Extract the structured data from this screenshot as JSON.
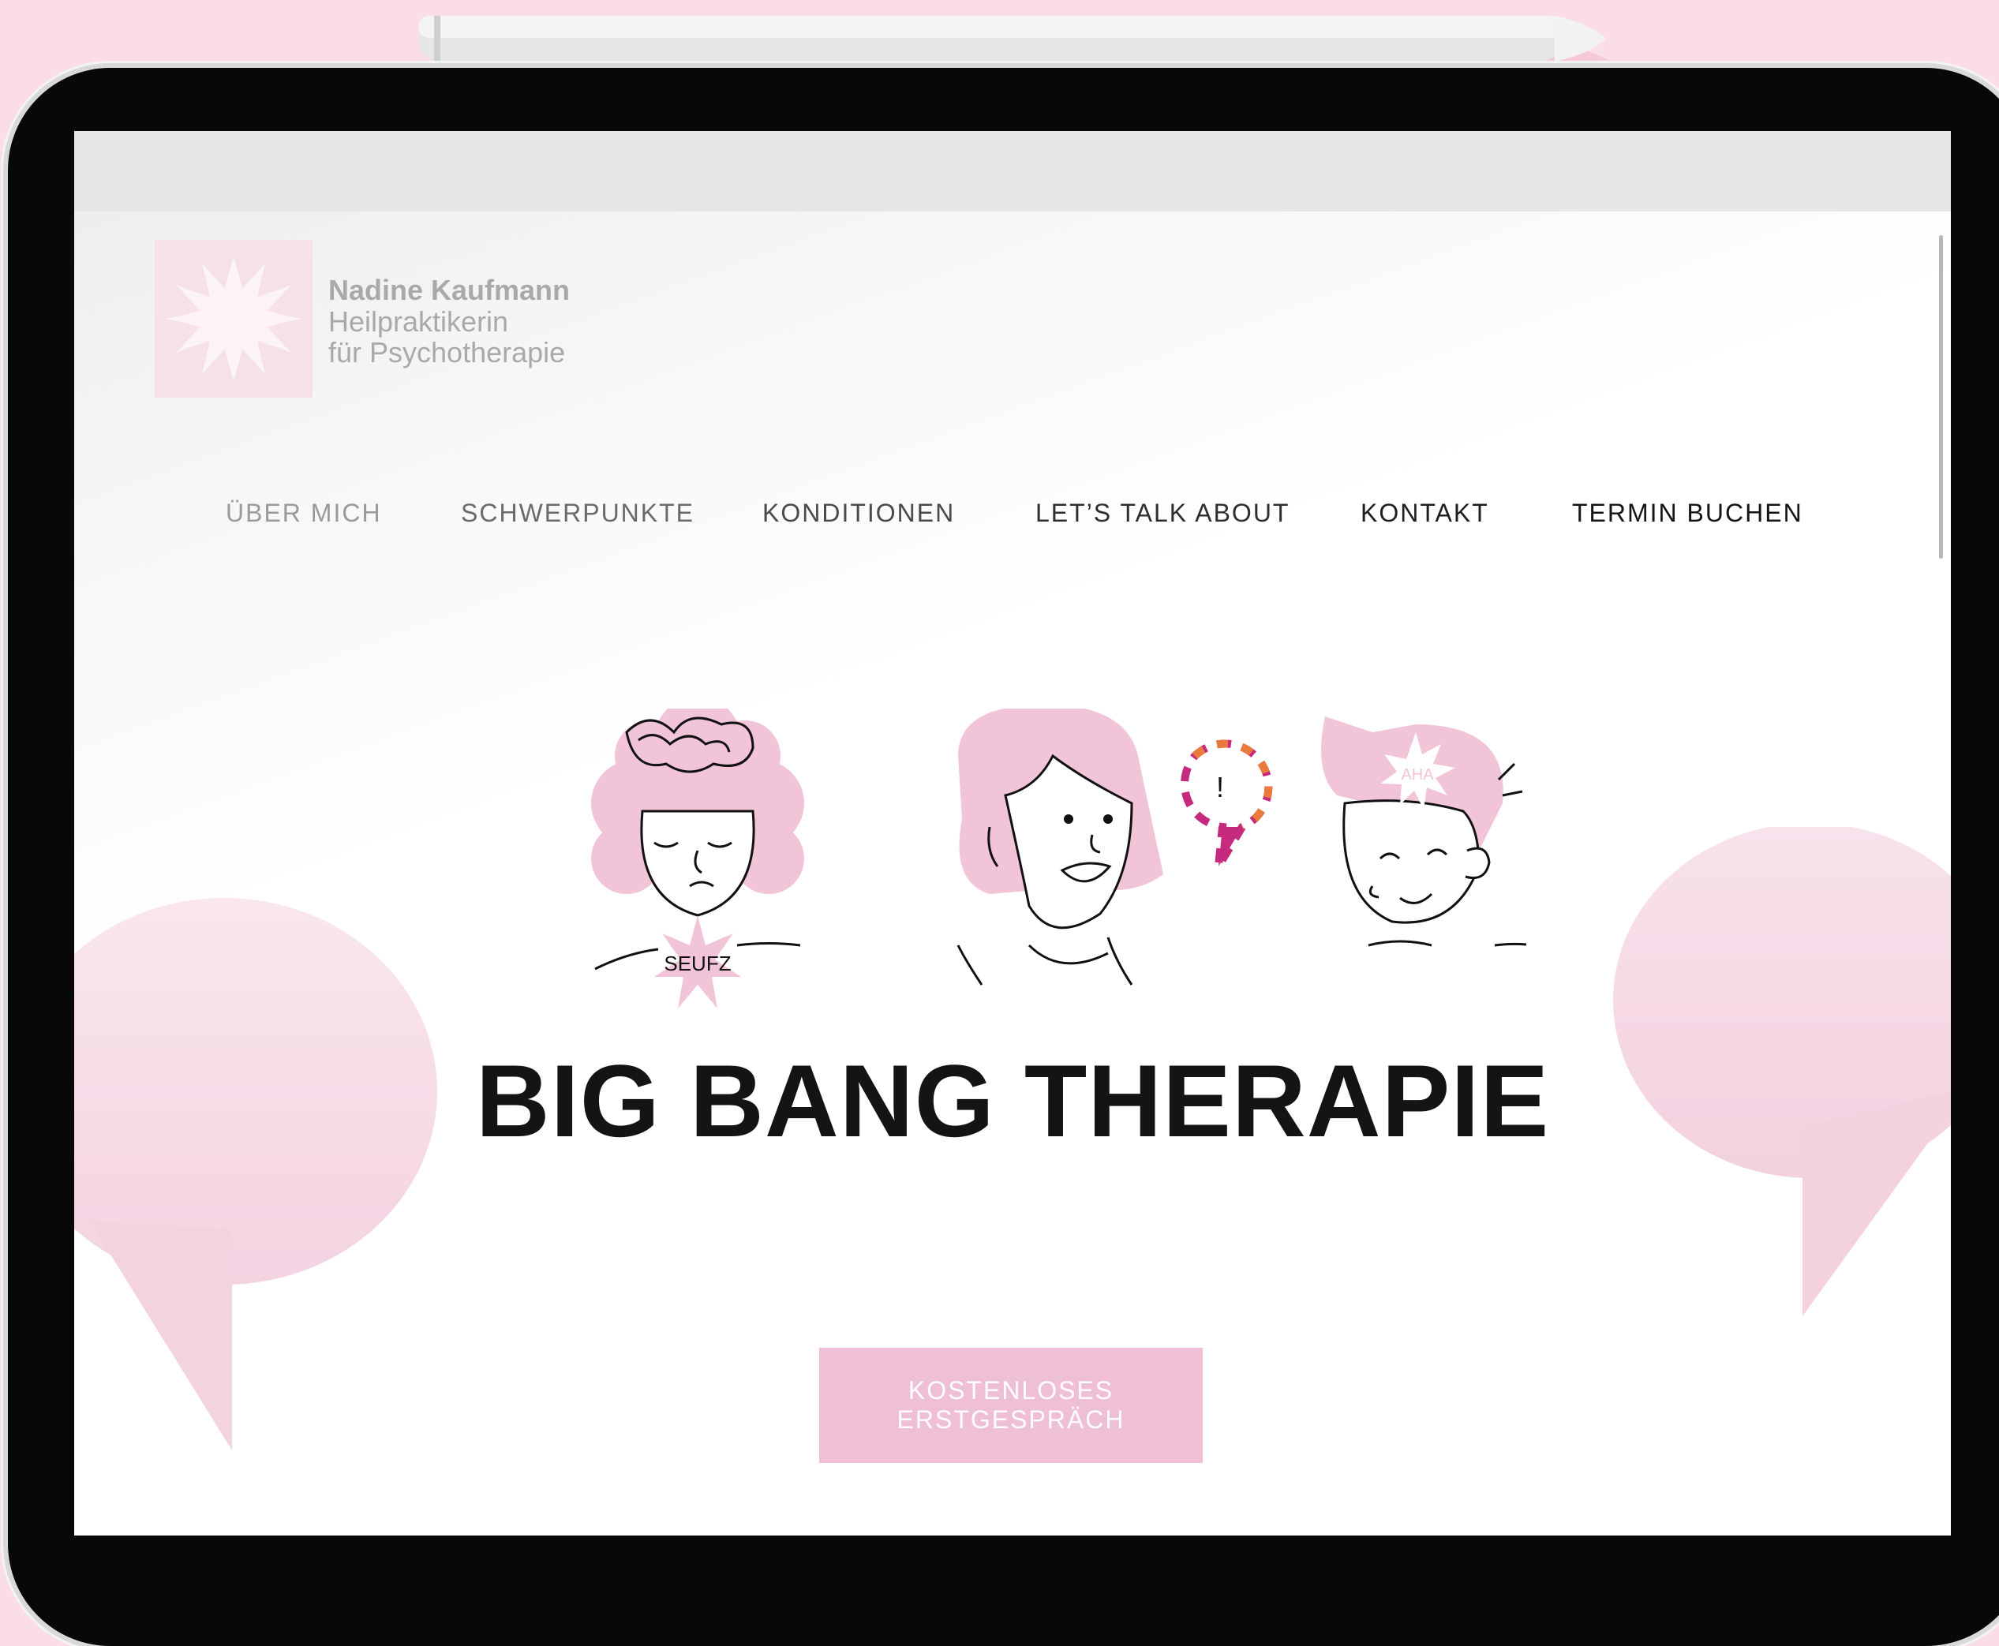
{
  "colors": {
    "background": "#fbdde9",
    "accent_pink": "#efbfd5",
    "bubble_pink": "#f5d6e3",
    "text_dark": "#141414",
    "text_gray": "#a9a9a9"
  },
  "brand": {
    "name": "Nadine Kaufmann",
    "line1": "Heilpraktikerin",
    "line2": "für Psychotherapie",
    "logo_icon": "star-burst-icon"
  },
  "nav": {
    "items": [
      {
        "label": "ÜBER MICH",
        "color": "#9a9a9a"
      },
      {
        "label": "SCHWERPUNKTE",
        "color": "#6a6a6a"
      },
      {
        "label": "KONDITIONEN",
        "color": "#4a4a4a"
      },
      {
        "label": "LET’S TALK ABOUT",
        "color": "#2e2e2e"
      },
      {
        "label": "KONTAKT",
        "color": "#1e1e1e"
      },
      {
        "label": "TERMIN BUCHEN",
        "color": "#141414"
      }
    ]
  },
  "illustration": {
    "sigh_label": "SEUFZ",
    "exclaim_label": "!",
    "aha_label": "AHA"
  },
  "hero": {
    "headline": "BIG BANG THERAPIE",
    "cta_label": "KOSTENLOSES ERSTGESPRÄCH"
  }
}
